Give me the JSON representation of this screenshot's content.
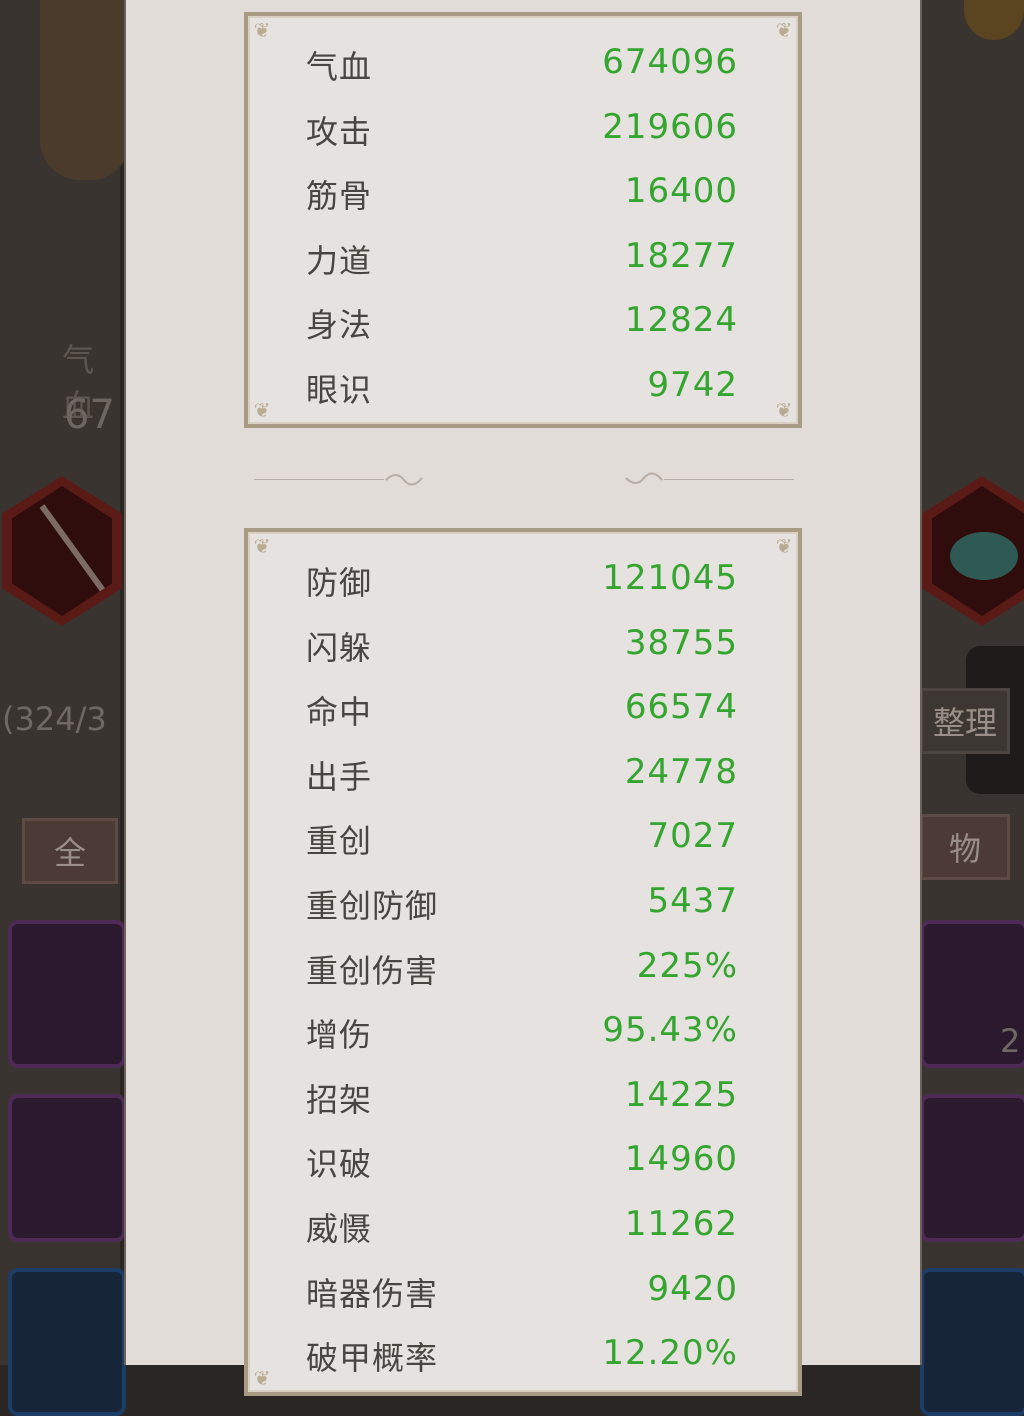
{
  "background": {
    "left_stat_label": "气血",
    "left_stat_value": "67",
    "bag_count": "(324/3",
    "filter_all": "全",
    "sort_button": "整理",
    "filter_item": "物",
    "right_item_count": "2"
  },
  "panel": {
    "basic_stats": [
      {
        "label": "气血",
        "value": "674096"
      },
      {
        "label": "攻击",
        "value": "219606"
      },
      {
        "label": "筋骨",
        "value": "16400"
      },
      {
        "label": "力道",
        "value": "18277"
      },
      {
        "label": "身法",
        "value": "12824"
      },
      {
        "label": "眼识",
        "value": "9742"
      }
    ],
    "combat_stats": [
      {
        "label": "防御",
        "value": "121045"
      },
      {
        "label": "闪躲",
        "value": "38755"
      },
      {
        "label": "命中",
        "value": "66574"
      },
      {
        "label": "出手",
        "value": "24778"
      },
      {
        "label": "重创",
        "value": "7027"
      },
      {
        "label": "重创防御",
        "value": "5437"
      },
      {
        "label": "重创伤害",
        "value": "225%"
      },
      {
        "label": "增伤",
        "value": "95.43%"
      },
      {
        "label": "招架",
        "value": "14225"
      },
      {
        "label": "识破",
        "value": "14960"
      },
      {
        "label": "威慑",
        "value": "11262"
      },
      {
        "label": "暗器伤害",
        "value": "9420"
      },
      {
        "label": "破甲概率",
        "value": "12.20%"
      }
    ]
  },
  "colors": {
    "value_green": "#34a52f",
    "panel_bg": "#e1dcd8",
    "box_border": "#a79b83"
  }
}
